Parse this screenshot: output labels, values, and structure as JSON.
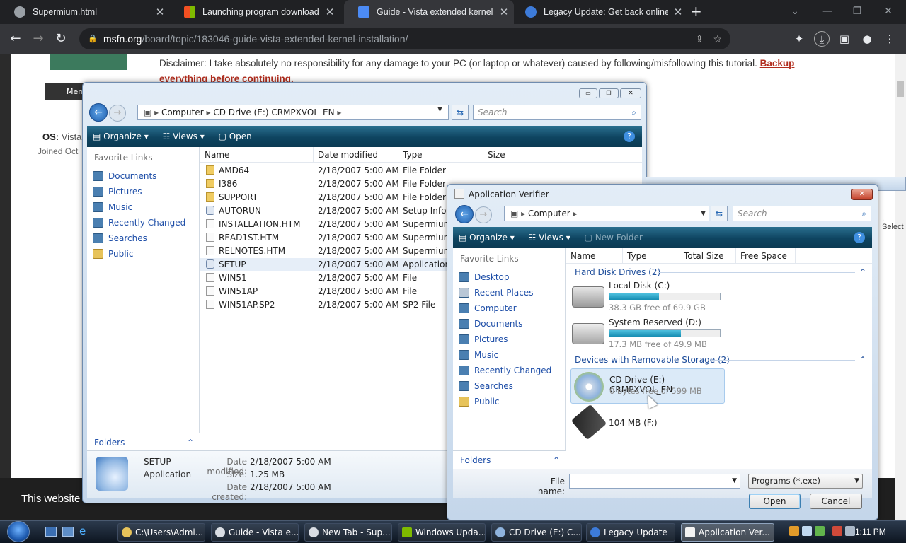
{
  "browser": {
    "tabs": [
      {
        "title": "Supermium.html",
        "icon": "globe-icon",
        "color": "#9aa0a6"
      },
      {
        "title": "Launching program download \\",
        "icon": "windows-flag-icon",
        "color": "#f25022"
      },
      {
        "title": "Guide - Vista extended kernel ins",
        "icon": "msfn-icon",
        "color": "#4c8bf5"
      },
      {
        "title": "Legacy Update: Get back online",
        "icon": "legacy-update-icon",
        "color": "#3d7bd9"
      }
    ],
    "new_tab": "+",
    "url_host": "msfn.org",
    "url_path": "/board/topic/183046-guide-vista-extended-kernel-installation/"
  },
  "webpage": {
    "menu_label": "Men",
    "disclaimer": "Disclaimer: I take absolutely no responsibility for any damage to your PC (or laptop or whatever) caused by following/misfollowing this tutorial.",
    "disclaimer_link": "Backup everything before continuing.",
    "os_label": "OS:",
    "os_value": "Vista",
    "joined": "Joined Oct",
    "cookie_banner": "This website",
    "select_text": ". Select"
  },
  "explorer": {
    "address": [
      "Computer",
      "CD Drive (E:) CRMPXVOL_EN"
    ],
    "search_placeholder": "Search",
    "commands": [
      "Organize",
      "Views",
      "Open"
    ],
    "favorite_links_title": "Favorite Links",
    "links": [
      "Documents",
      "Pictures",
      "Music",
      "Recently Changed",
      "Searches",
      "Public"
    ],
    "folders_label": "Folders",
    "columns": [
      "Name",
      "Date modified",
      "Type",
      "Size"
    ],
    "files": [
      {
        "name": "AMD64",
        "date": "2/18/2007 5:00 AM",
        "type": "File Folder",
        "kind": "folder"
      },
      {
        "name": "I386",
        "date": "2/18/2007 5:00 AM",
        "type": "File Folder",
        "kind": "folder"
      },
      {
        "name": "SUPPORT",
        "date": "2/18/2007 5:00 AM",
        "type": "File Folder",
        "kind": "folder"
      },
      {
        "name": "AUTORUN",
        "date": "2/18/2007 5:00 AM",
        "type": "Setup Infor",
        "kind": "setup"
      },
      {
        "name": "INSTALLATION.HTM",
        "date": "2/18/2007 5:00 AM",
        "type": "Supermium",
        "kind": "doc"
      },
      {
        "name": "READ1ST.HTM",
        "date": "2/18/2007 5:00 AM",
        "type": "Supermium",
        "kind": "doc"
      },
      {
        "name": "RELNOTES.HTM",
        "date": "2/18/2007 5:00 AM",
        "type": "Supermium",
        "kind": "doc"
      },
      {
        "name": "SETUP",
        "date": "2/18/2007 5:00 AM",
        "type": "Application",
        "kind": "app"
      },
      {
        "name": "WIN51",
        "date": "2/18/2007 5:00 AM",
        "type": "File",
        "kind": "doc"
      },
      {
        "name": "WIN51AP",
        "date": "2/18/2007 5:00 AM",
        "type": "File",
        "kind": "doc"
      },
      {
        "name": "WIN51AP.SP2",
        "date": "2/18/2007 5:00 AM",
        "type": "SP2 File",
        "kind": "doc"
      }
    ],
    "details": {
      "name": "SETUP",
      "type": "Application",
      "date_modified_label": "Date modified:",
      "date_modified": "2/18/2007 5:00 AM",
      "size_label": "Size:",
      "size": "1.25 MB",
      "date_created_label": "Date created:",
      "date_created": "2/18/2007 5:00 AM"
    }
  },
  "verifier": {
    "title": "Application Verifier",
    "address": [
      "Computer"
    ],
    "search_placeholder": "Search",
    "commands": [
      "Organize",
      "Views",
      "New Folder"
    ],
    "favorite_links_title": "Favorite Links",
    "links": [
      "Desktop",
      "Recent Places",
      "Computer",
      "Documents",
      "Pictures",
      "Music",
      "Recently Changed",
      "Searches",
      "Public"
    ],
    "folders_label": "Folders",
    "columns": [
      "Name",
      "Type",
      "Total Size",
      "Free Space"
    ],
    "group_hdd": "Hard Disk Drives (2)",
    "group_removable": "Devices with Removable Storage (2)",
    "drives": [
      {
        "name": "Local Disk (C:)",
        "free": "38.3 GB free of 69.9 GB",
        "used_fraction": 0.45
      },
      {
        "name": "System Reserved (D:)",
        "free": "17.3 MB free of 49.9 MB",
        "used_fraction": 0.65
      }
    ],
    "removable": [
      {
        "name": "CD Drive (E:) CRMPXVOL_EN",
        "free": "0 bytes free of 599 MB"
      },
      {
        "name": "104 MB (F:)",
        "free": ""
      }
    ],
    "file_name_label": "File name:",
    "file_name_value": "",
    "filter": "Programs (*.exe)",
    "open_button": "Open",
    "cancel_button": "Cancel"
  },
  "taskbar": {
    "items": [
      {
        "label": "C:\\Users\\Admi..."
      },
      {
        "label": "Guide - Vista e..."
      },
      {
        "label": "New Tab - Sup..."
      },
      {
        "label": "Windows Upda..."
      },
      {
        "label": "CD Drive (E:) C..."
      },
      {
        "label": "Legacy Update"
      },
      {
        "label": "Application Ver..."
      }
    ],
    "clock": "1:11 PM"
  }
}
